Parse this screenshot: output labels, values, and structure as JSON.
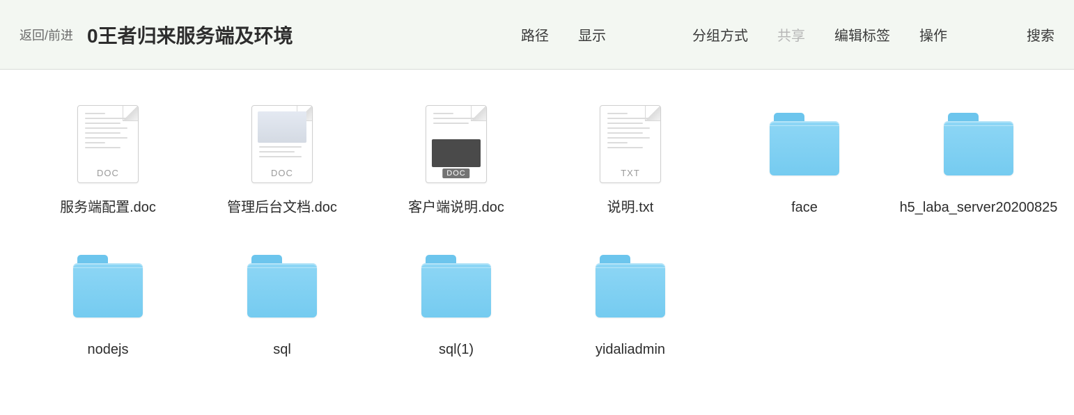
{
  "toolbar": {
    "nav_back_forward": "返回/前进",
    "title": "0王者归来服务端及环境",
    "menu": {
      "path": "路径",
      "display": "显示",
      "group_by": "分组方式",
      "share": "共享",
      "edit_tags": "编辑标签",
      "action": "操作",
      "search": "搜索"
    }
  },
  "items": [
    {
      "name": "服务端配置.doc",
      "type": "doc",
      "preview": "lines",
      "badge": "DOC"
    },
    {
      "name": "管理后台文档.doc",
      "type": "doc",
      "preview": "image",
      "badge": "DOC"
    },
    {
      "name": "客户端说明.doc",
      "type": "doc",
      "preview": "dark",
      "badge": "DOC"
    },
    {
      "name": "说明.txt",
      "type": "doc",
      "preview": "lines",
      "badge": "TXT"
    },
    {
      "name": "face",
      "type": "folder"
    },
    {
      "name": "h5_laba_server20200825",
      "type": "folder"
    },
    {
      "name": "nodejs",
      "type": "folder"
    },
    {
      "name": "sql",
      "type": "folder"
    },
    {
      "name": "sql(1)",
      "type": "folder"
    },
    {
      "name": "yidaliadmin",
      "type": "folder"
    }
  ]
}
